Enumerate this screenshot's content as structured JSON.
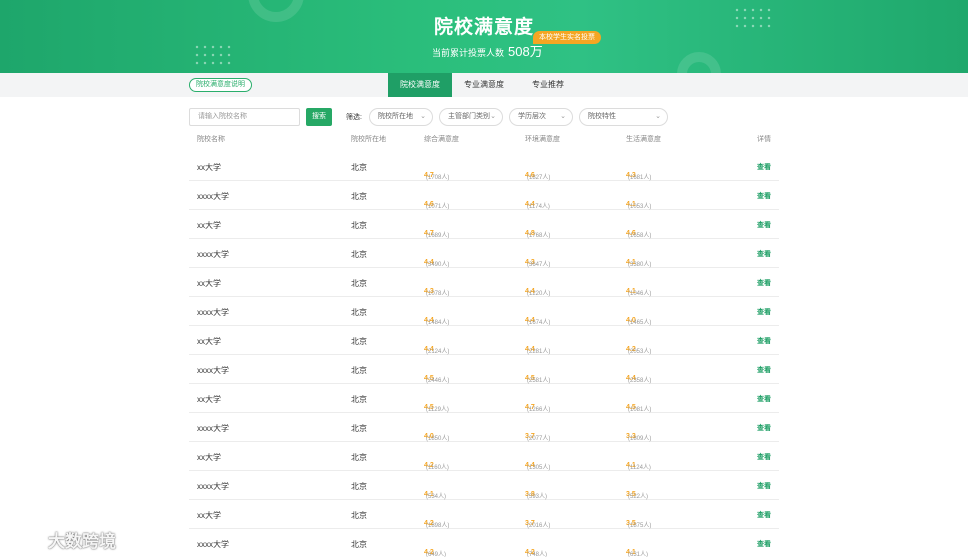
{
  "banner": {
    "title": "院校满意度",
    "stat_label": "当前累计投票人数",
    "stat_value": "508万",
    "vote_tag": "本校学生实名投票"
  },
  "nav": {
    "explain": "院校满意度说明",
    "tabs": [
      {
        "label": "院校满意度",
        "active": true
      },
      {
        "label": "专业满意度",
        "active": false
      },
      {
        "label": "专业推荐",
        "active": false
      }
    ]
  },
  "search": {
    "placeholder": "请输入院校名称",
    "button": "搜索"
  },
  "filter": {
    "label": "筛选:",
    "selects": [
      "院校所在地",
      "主管部门类别",
      "学历层次",
      "院校特性"
    ]
  },
  "table": {
    "headers": [
      "院校名称",
      "院校所在地",
      "综合满意度",
      "环境满意度",
      "生活满意度",
      "详情"
    ],
    "rows": [
      {
        "name": "xx大学",
        "loc": "北京",
        "s1": "4.7",
        "n1": "(1708人)",
        "s2": "4.6",
        "n2": "(1827人)",
        "s3": "4.3",
        "n3": "(1681人)",
        "view": "查看"
      },
      {
        "name": "xxxx大学",
        "loc": "北京",
        "s1": "4.6",
        "n1": "(1071人)",
        "s2": "4.4",
        "n2": "(1174人)",
        "s3": "4.1",
        "n3": "(1053人)",
        "view": "查看"
      },
      {
        "name": "xx大学",
        "loc": "北京",
        "s1": "4.7",
        "n1": "(1689人)",
        "s2": "4.8",
        "n2": "(1768人)",
        "s3": "4.6",
        "n3": "(1658人)",
        "view": "查看"
      },
      {
        "name": "xxxx大学",
        "loc": "北京",
        "s1": "4.4",
        "n1": "(3490人)",
        "s2": "4.3",
        "n2": "(3647人)",
        "s3": "4.1",
        "n3": "(3380人)",
        "view": "查看"
      },
      {
        "name": "xx大学",
        "loc": "北京",
        "s1": "4.3",
        "n1": "(1078人)",
        "s2": "4.4",
        "n2": "(1220人)",
        "s3": "4.1",
        "n3": "(1046人)",
        "view": "查看"
      },
      {
        "name": "xxxx大学",
        "loc": "北京",
        "s1": "4.4",
        "n1": "(1484人)",
        "s2": "4.4",
        "n2": "(1674人)",
        "s3": "4.0",
        "n3": "(1465人)",
        "view": "查看"
      },
      {
        "name": "xx大学",
        "loc": "北京",
        "s1": "4.4",
        "n1": "(2124人)",
        "s2": "4.4",
        "n2": "(2281人)",
        "s3": "4.2",
        "n3": "(2053人)",
        "view": "查看"
      },
      {
        "name": "xxxx大学",
        "loc": "北京",
        "s1": "4.5",
        "n1": "(2446人)",
        "s2": "4.5",
        "n2": "(2581人)",
        "s3": "4.4",
        "n3": "(2358人)",
        "view": "查看"
      },
      {
        "name": "xx大学",
        "loc": "北京",
        "s1": "4.5",
        "n1": "(1129人)",
        "s2": "4.7",
        "n2": "(1266人)",
        "s3": "4.5",
        "n3": "(1081人)",
        "view": "查看"
      },
      {
        "name": "xxxx大学",
        "loc": "北京",
        "s1": "4.0",
        "n1": "(1850人)",
        "s2": "3.7",
        "n2": "(2077人)",
        "s3": "3.3",
        "n3": "(1809人)",
        "view": "查看"
      },
      {
        "name": "xx大学",
        "loc": "北京",
        "s1": "4.2",
        "n1": "(1160人)",
        "s2": "4.4",
        "n2": "(1305人)",
        "s3": "4.1",
        "n3": "(1124人)",
        "view": "查看"
      },
      {
        "name": "xxxx大学",
        "loc": "北京",
        "s1": "4.1",
        "n1": "(534人)",
        "s2": "3.8",
        "n2": "(593人)",
        "s3": "3.5",
        "n3": "(522人)",
        "view": "查看"
      },
      {
        "name": "xx大学",
        "loc": "北京",
        "s1": "4.2",
        "n1": "(1898人)",
        "s2": "3.7",
        "n2": "(2016人)",
        "s3": "3.5",
        "n3": "(1875人)",
        "view": "查看"
      },
      {
        "name": "xxxx大学",
        "loc": "北京",
        "s1": "4.2",
        "n1": "(649人)",
        "s2": "4.2",
        "n2": "(748人)",
        "s3": "4.1",
        "n3": "(631人)",
        "view": "查看"
      }
    ]
  },
  "watermark": {
    "text": "大数跨境",
    "colors": {
      "accent": "#1f9f66",
      "score": "#f5a623"
    }
  }
}
